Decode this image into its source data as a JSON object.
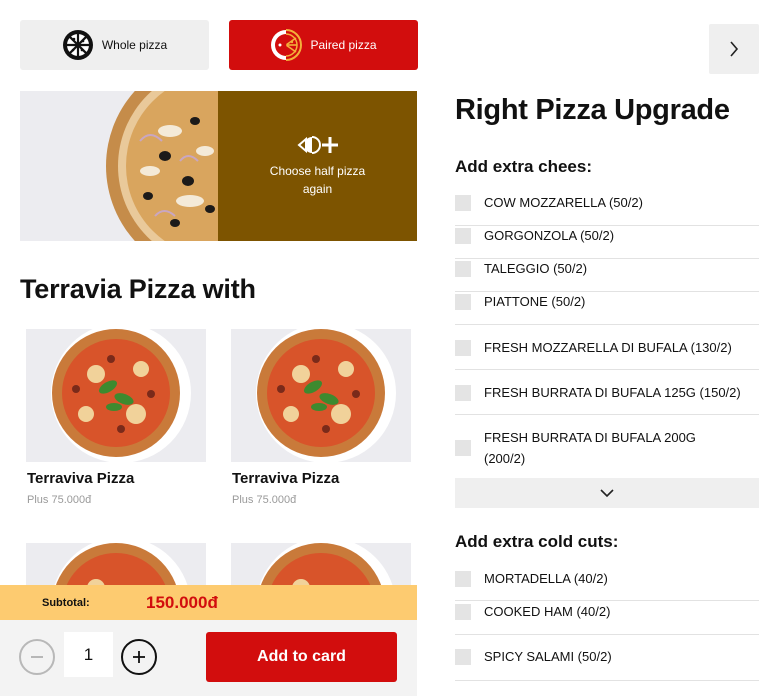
{
  "tabs": {
    "whole": {
      "label": "Whole pizza",
      "icon": "pizza-whole-icon"
    },
    "paired": {
      "label": "Paired pizza",
      "icon": "pizza-half-icon"
    }
  },
  "half_panel": {
    "choose_label": "Choose half pizza again",
    "icon": "add-half-icon"
  },
  "left": {
    "section_title": "Terravia Pizza with",
    "cards": [
      {
        "name": "Terraviva Pizza",
        "price": "Plus 75.000đ"
      },
      {
        "name": "Terraviva Pizza",
        "price": "Plus 75.000đ"
      },
      {
        "name": "",
        "price": ""
      },
      {
        "name": "",
        "price": ""
      }
    ]
  },
  "subtotal": {
    "label": "Subtotal:",
    "value": "150.000đ"
  },
  "cart": {
    "quantity": "1",
    "add_label": "Add to card"
  },
  "right": {
    "title": "Right Pizza Upgrade",
    "cheese_title": "Add extra chees:",
    "cheese_options": [
      "COW MOZZARELLA (50/2)",
      "GORGONZOLA (50/2)",
      "TALEGGIO (50/2)",
      "PIATTONE (50/2)",
      "FRESH MOZZARELLA DI BUFALA (130/2)",
      "FRESH BURRATA DI BUFALA 125G (150/2)",
      "FRESH BURRATA DI BUFALA 200G (200/2)"
    ],
    "cold_cuts_title": "Add extra cold cuts:",
    "cold_cut_options": [
      "MORTADELLA (40/2)",
      "COOKED HAM (40/2)",
      "SPICY SALAMI (50/2)"
    ]
  },
  "colors": {
    "accent": "#d20d0d",
    "subtotal_bg": "#fdcb70",
    "half_bg": "#7d5400"
  }
}
